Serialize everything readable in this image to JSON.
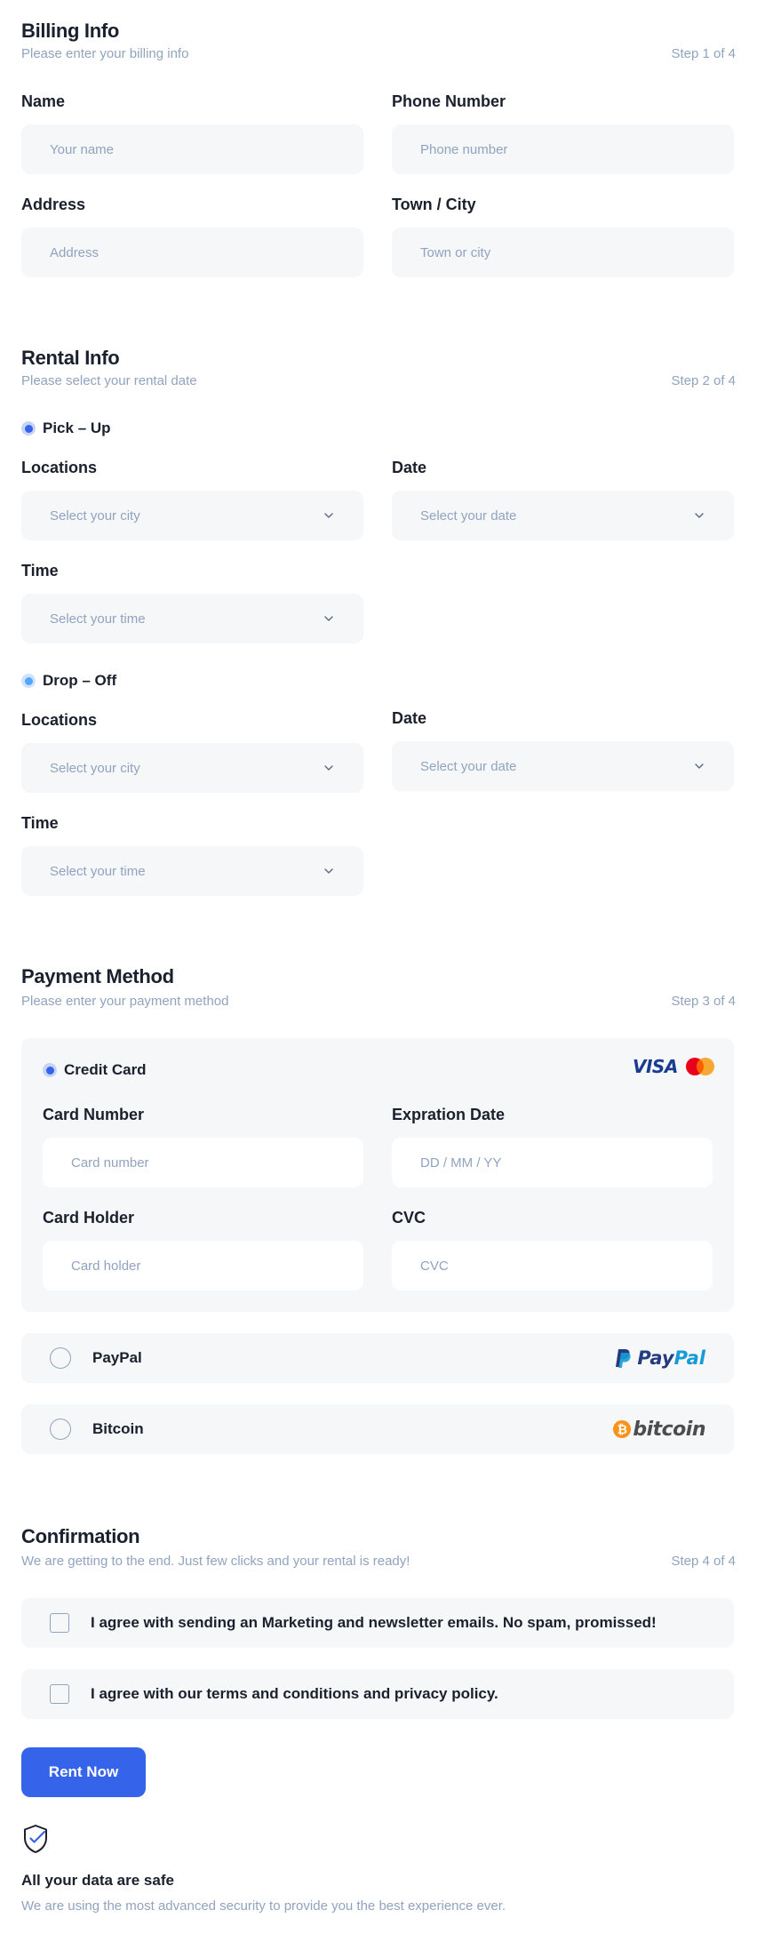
{
  "billing": {
    "title": "Billing Info",
    "subtitle": "Please enter your billing info",
    "step": "Step 1 of 4",
    "name_label": "Name",
    "name_placeholder": "Your name",
    "phone_label": "Phone Number",
    "phone_placeholder": "Phone number",
    "address_label": "Address",
    "address_placeholder": "Address",
    "city_label": "Town / City",
    "city_placeholder": "Town or city"
  },
  "rental": {
    "title": "Rental Info",
    "subtitle": "Please select your rental date",
    "step": "Step 2 of 4",
    "pickup": {
      "label": "Pick – Up",
      "locations_label": "Locations",
      "locations_placeholder": "Select your city",
      "date_label": "Date",
      "date_placeholder": "Select your date",
      "time_label": "Time",
      "time_placeholder": "Select your time"
    },
    "dropoff": {
      "label": "Drop – Off",
      "locations_label": "Locations",
      "locations_placeholder": "Select your city",
      "date_label": "Date",
      "date_placeholder": "Select your date",
      "time_label": "Time",
      "time_placeholder": "Select your time"
    }
  },
  "payment": {
    "title": "Payment Method",
    "subtitle": "Please enter your payment method",
    "step": "Step 3 of 4",
    "credit_card": {
      "label": "Credit Card",
      "visa_text": "VISA",
      "card_number_label": "Card Number",
      "card_number_placeholder": "Card number",
      "expiration_label": "Expration Date",
      "expiration_placeholder": "DD / MM / YY",
      "holder_label": "Card Holder",
      "holder_placeholder": "Card holder",
      "cvc_label": "CVC",
      "cvc_placeholder": "CVC"
    },
    "paypal": {
      "label": "PayPal",
      "logo_text_a": "Pay",
      "logo_text_b": "Pal"
    },
    "bitcoin": {
      "label": "Bitcoin",
      "logo_symbol": "₿",
      "logo_text": "bitcoin"
    }
  },
  "confirmation": {
    "title": "Confirmation",
    "subtitle": "We are getting to the end. Just few clicks and your rental is ready!",
    "step": "Step 4 of 4",
    "marketing_text": "I agree with sending an Marketing and newsletter emails. No spam, promissed!",
    "terms_text": "I agree with our terms and conditions and privacy policy.",
    "button_label": "Rent Now",
    "safe_title": "All your data are safe",
    "safe_text": "We are using the most advanced security to provide you the best experience ever."
  },
  "colors": {
    "accent": "#3563e9",
    "muted": "#90a3bf",
    "field_bg": "#f6f7f9",
    "text": "#1a202c"
  }
}
